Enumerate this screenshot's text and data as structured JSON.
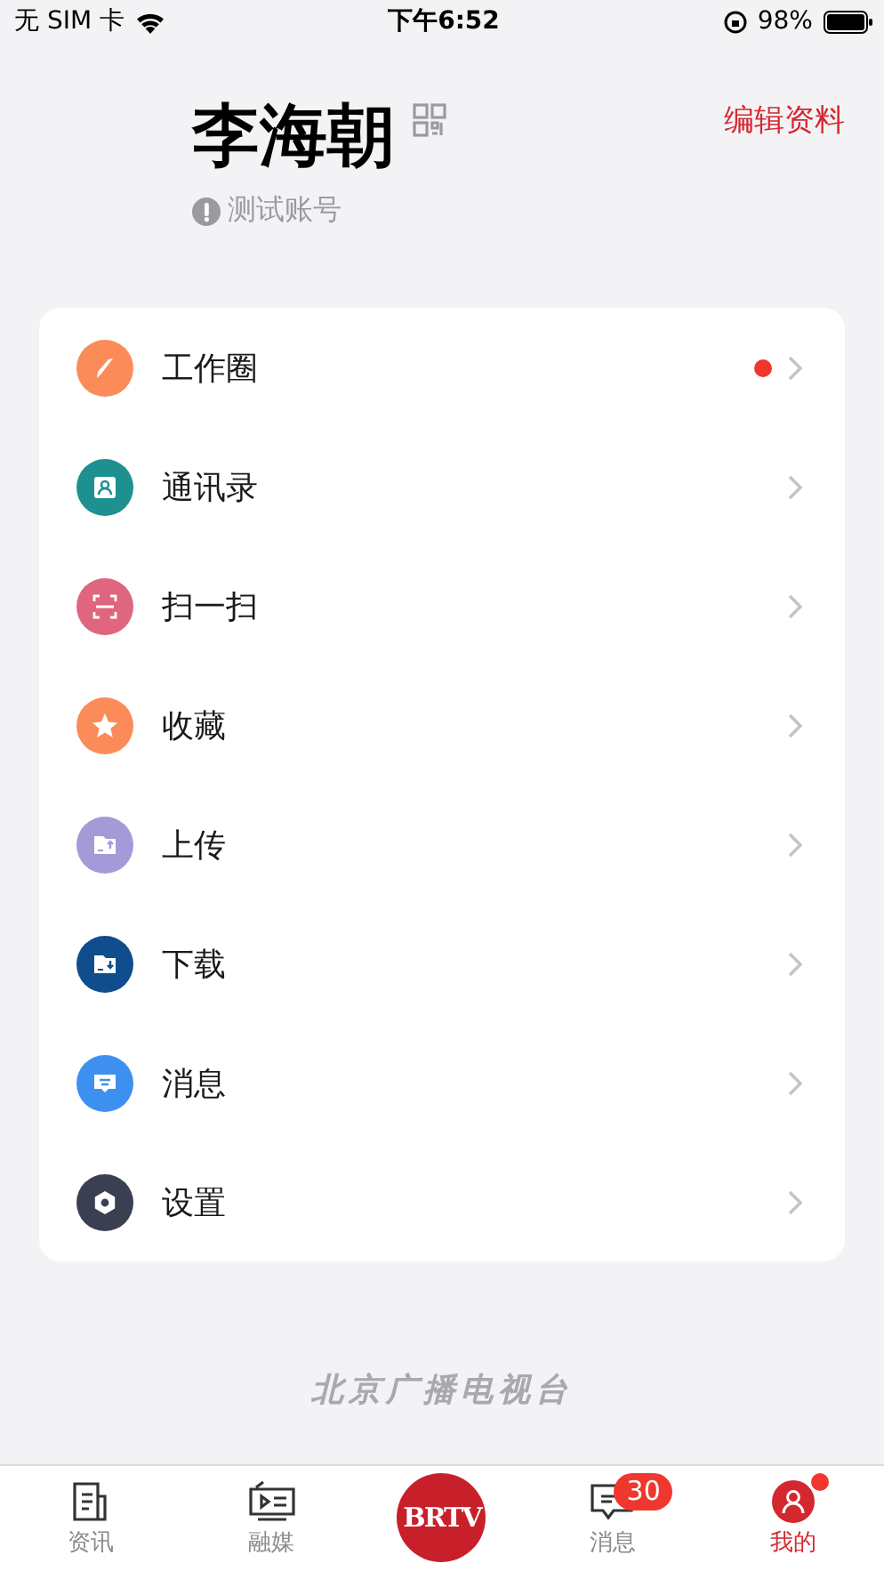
{
  "status_bar": {
    "carrier": "无 SIM 卡",
    "time": "下午6:52",
    "battery": "98%"
  },
  "profile": {
    "name": "李海朝",
    "account_label": "测试账号",
    "edit_button": "编辑资料"
  },
  "menu": [
    {
      "label": "工作圈",
      "kind": "compass",
      "color": "#fb8c5a",
      "dot": true
    },
    {
      "label": "通讯录",
      "kind": "contacts",
      "color": "#1e9090",
      "dot": false
    },
    {
      "label": "扫一扫",
      "kind": "scan",
      "color": "#e0657f",
      "dot": false
    },
    {
      "label": "收藏",
      "kind": "star",
      "color": "#fb8c5a",
      "dot": false
    },
    {
      "label": "上传",
      "kind": "upload",
      "color": "#a49ad8",
      "dot": false
    },
    {
      "label": "下载",
      "kind": "download",
      "color": "#0f4d8c",
      "dot": false
    },
    {
      "label": "消息",
      "kind": "message",
      "color": "#3e90f0",
      "dot": false
    },
    {
      "label": "设置",
      "kind": "settings",
      "color": "#3b3f52",
      "dot": false
    }
  ],
  "brand_footer": "北京广播电视台",
  "tab_bar": [
    {
      "label": "资讯",
      "kind": "news",
      "selected": false
    },
    {
      "label": "融媒",
      "kind": "media",
      "selected": false
    },
    {
      "label": "BRTV",
      "kind": "logo",
      "selected": false
    },
    {
      "label": "消息",
      "kind": "message",
      "selected": false,
      "badge": "30"
    },
    {
      "label": "我的",
      "kind": "profile",
      "selected": true,
      "dot": true
    }
  ]
}
